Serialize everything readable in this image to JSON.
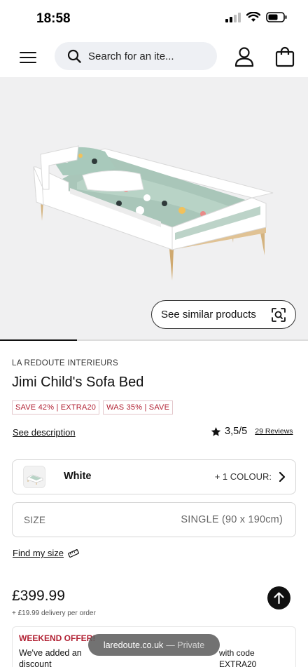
{
  "status_bar": {
    "time": "18:58"
  },
  "header": {
    "search_placeholder": "Search for an ite..."
  },
  "hero": {
    "similar_products_label": "See similar products",
    "gallery_progress": 0.25
  },
  "product": {
    "brand": "LA REDOUTE INTERIEURS",
    "title": "Jimi Child's Sofa Bed",
    "badges": [
      "SAVE 42% | EXTRA20",
      "WAS 35% | SAVE"
    ],
    "see_description": "See description",
    "rating": "3,5/5",
    "reviews": "29 Reviews",
    "price": "£399.99",
    "delivery": "+ £19.99 delivery per order"
  },
  "colour": {
    "selected": "White",
    "extra": "+ 1 COLOUR:"
  },
  "size": {
    "label": "SIZE",
    "value": "SINGLE (90 x 190cm)"
  },
  "find_my_size": "Find my size",
  "offer": {
    "title": "WEEKEND OFFER!",
    "text_left": "We've added an",
    "text_left_2": "discount",
    "text_right": "with code",
    "text_right_2": "EXTRA20"
  },
  "browser": {
    "domain": "laredoute.co.uk",
    "mode": "— Private"
  },
  "colors": {
    "accent_red": "#b22234",
    "search_bg": "#eef0f4",
    "hero_bg": "#f0f0f1"
  }
}
